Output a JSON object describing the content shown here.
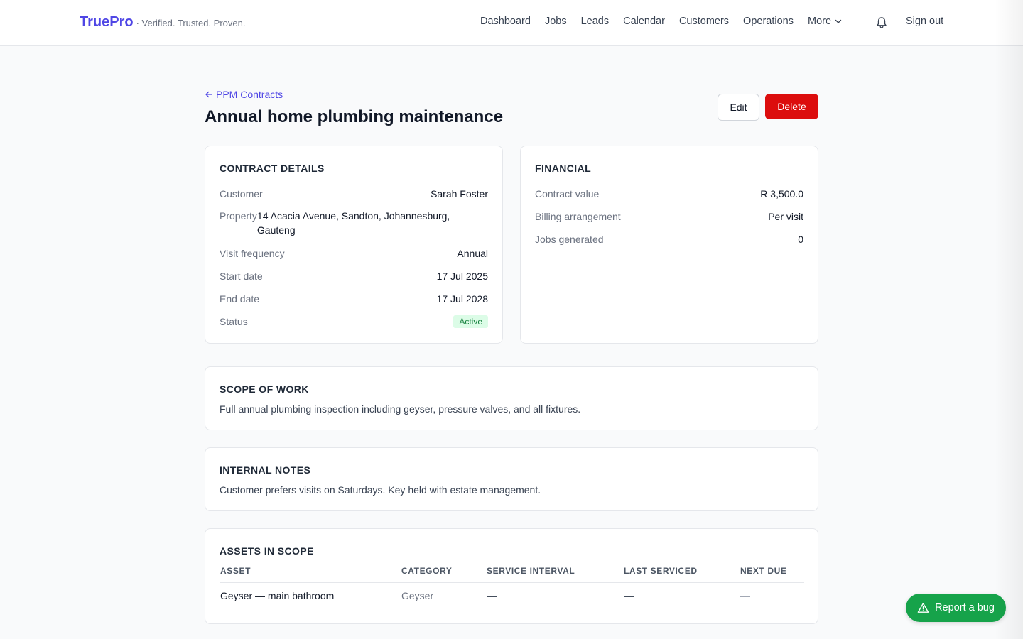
{
  "brand": {
    "name": "TruePro",
    "tagline": "· Verified. Trusted. Proven.",
    "color": "#4f46e5"
  },
  "nav": {
    "items": [
      "Dashboard",
      "Jobs",
      "Leads",
      "Calendar",
      "Customers",
      "Operations"
    ],
    "more_label": "More",
    "sign_out": "Sign out"
  },
  "header": {
    "back_label": "PPM Contracts",
    "title": "Annual home plumbing maintenance",
    "edit_label": "Edit",
    "delete_label": "Delete",
    "delete_color": "#dc0d0d"
  },
  "contract_details": {
    "title": "Contract details",
    "rows": [
      {
        "label": "Customer",
        "value": "Sarah Foster"
      },
      {
        "label": "Property",
        "value": "14 Acacia Avenue, Sandton, Johannesburg, Gauteng"
      },
      {
        "label": "Visit frequency",
        "value": "Annual"
      },
      {
        "label": "Start date",
        "value": "17 Jul 2025"
      },
      {
        "label": "End date",
        "value": "17 Jul 2028"
      },
      {
        "label": "Status",
        "value": "Active"
      }
    ]
  },
  "financial": {
    "title": "Financial",
    "rows": [
      {
        "label": "Contract value",
        "value": "R 3,500.0"
      },
      {
        "label": "Billing arrangement",
        "value": "Per visit"
      },
      {
        "label": "Jobs generated",
        "value": "0"
      }
    ]
  },
  "scope": {
    "title": "Scope of work",
    "text": "Full annual plumbing inspection including geyser, pressure valves, and all fixtures."
  },
  "notes": {
    "title": "Internal notes",
    "text": "Customer prefers visits on Saturdays. Key held with estate management."
  },
  "assets": {
    "title": "Assets in scope",
    "columns": [
      "Asset",
      "Category",
      "Service interval",
      "Last serviced",
      "Next due"
    ],
    "rows": [
      {
        "asset": "Geyser — main bathroom",
        "category": "Geyser",
        "interval": "—",
        "last": "—",
        "next": "—"
      }
    ]
  },
  "bug_button": {
    "label": "Report a bug",
    "color": "#16a34a"
  },
  "status_colors": {
    "active_bg": "#dcfce7",
    "active_text": "#15803d"
  }
}
